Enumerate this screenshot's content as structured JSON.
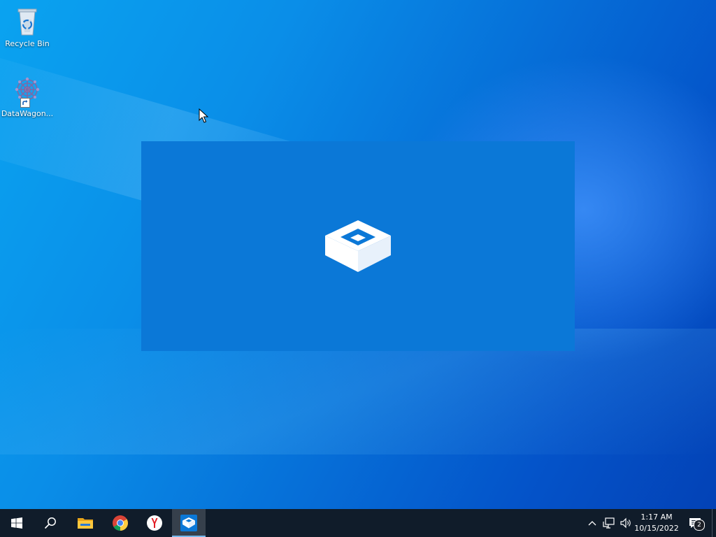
{
  "desktop": {
    "icons": [
      {
        "label": "Recycle Bin",
        "icon": "recycle-bin-icon"
      },
      {
        "label": "DataWagon...",
        "icon": "datawagon-app-icon"
      }
    ]
  },
  "splash": {
    "app_icon": "sandbox-box-icon",
    "background_color": "#0b78d7"
  },
  "taskbar": {
    "buttons": [
      {
        "name": "start",
        "icon": "windows-logo-icon"
      },
      {
        "name": "search",
        "icon": "search-icon"
      },
      {
        "name": "file-explorer",
        "icon": "folder-icon"
      },
      {
        "name": "chrome",
        "icon": "chrome-icon"
      },
      {
        "name": "yandex-browser",
        "icon": "yandex-icon"
      },
      {
        "name": "sandbox",
        "icon": "sandbox-box-icon",
        "active": true
      }
    ],
    "tray": {
      "icons": [
        "chevron-up-icon",
        "network-icon",
        "volume-icon"
      ],
      "time": "1:17 AM",
      "date": "10/15/2022",
      "notifications_count": "2"
    }
  },
  "colors": {
    "taskbar": "#101c2a",
    "accent": "#0b78d7",
    "active_underline": "#76b9ed"
  }
}
